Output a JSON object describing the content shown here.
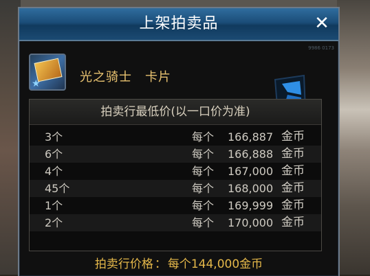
{
  "window": {
    "title": "上架拍卖品",
    "corner_code": "9986 0173"
  },
  "item": {
    "name": "光之骑士　卡片",
    "icon": "knight-card-icon"
  },
  "price_list": {
    "header": "拍卖行最低价(以一口价为准)",
    "rows": [
      {
        "qty": "3个",
        "each": "每个",
        "amount": "166,887",
        "currency": "金币"
      },
      {
        "qty": "6个",
        "each": "每个",
        "amount": "166,888",
        "currency": "金币"
      },
      {
        "qty": "4个",
        "each": "每个",
        "amount": "167,000",
        "currency": "金币"
      },
      {
        "qty": "45个",
        "each": "每个",
        "amount": "168,000",
        "currency": "金币"
      },
      {
        "qty": "1个",
        "each": "每个",
        "amount": "169,999",
        "currency": "金币"
      },
      {
        "qty": "2个",
        "each": "每个",
        "amount": "170,000",
        "currency": "金币"
      }
    ]
  },
  "sale_price": {
    "label": "拍卖行价格",
    "separator": "：",
    "value": "每个144,000金币"
  },
  "colors": {
    "title_bar": "#1b4d78",
    "item_name": "#e8c270",
    "sale_price": "#e5b84a",
    "text": "#cfcbc2"
  }
}
